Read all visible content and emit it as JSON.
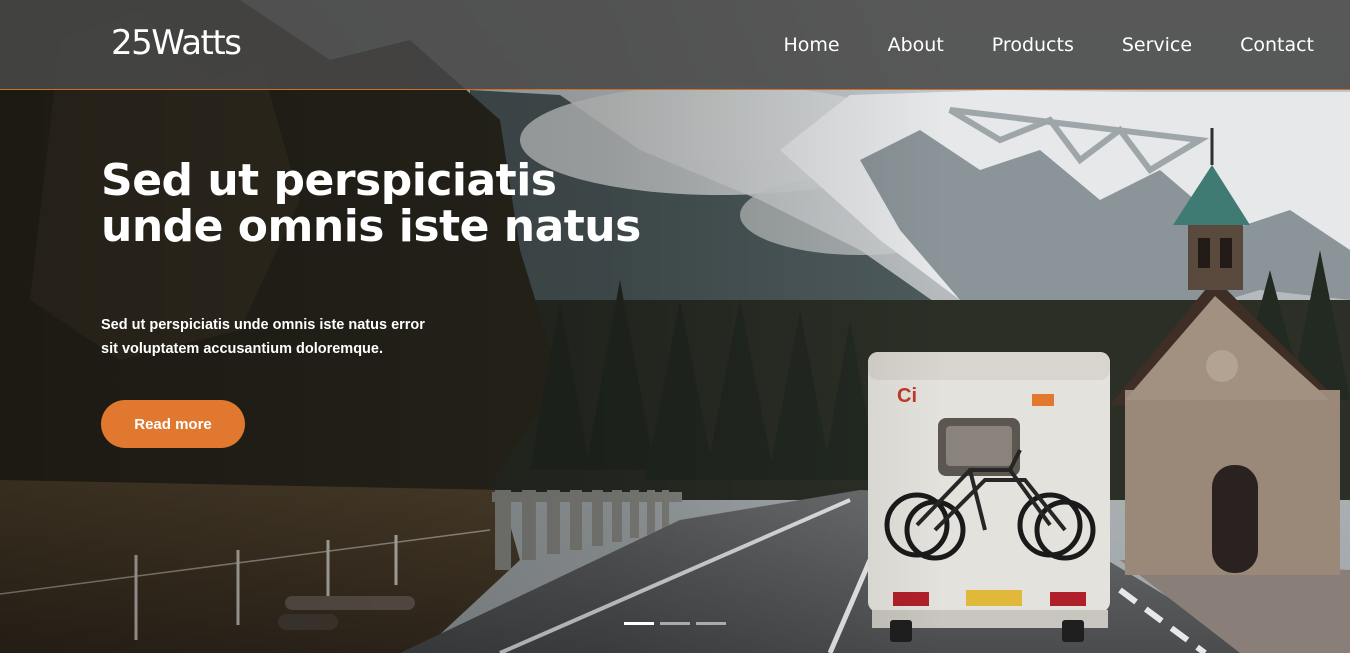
{
  "header": {
    "logo": "25Watts",
    "nav": [
      {
        "label": "Home"
      },
      {
        "label": "About"
      },
      {
        "label": "Products"
      },
      {
        "label": "Service"
      },
      {
        "label": "Contact"
      }
    ]
  },
  "hero": {
    "headline_line1": "Sed ut perspiciatis",
    "headline_line2": "unde omnis iste natus",
    "subtext_line1": "Sed ut perspiciatis unde omnis iste natus error",
    "subtext_line2": "sit voluptatem accusantium doloremque.",
    "cta_label": "Read more",
    "background_image": "photo of a camper van with two bicycles on the back driving on a mountain road past a pine forest, snowy peaks and a small stone chapel"
  },
  "slider": {
    "slide_count": 3,
    "active_index": 0
  },
  "colors": {
    "accent": "#e0782f",
    "header_bg": "#484848",
    "header_border": "#c8702e",
    "text": "#ffffff"
  }
}
